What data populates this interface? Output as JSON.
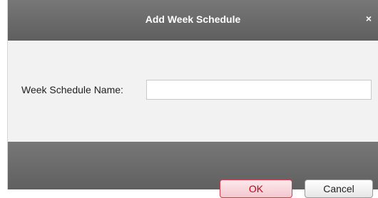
{
  "dialog": {
    "title": "Add Week Schedule",
    "close_icon": "close-icon",
    "close_glyph": "×"
  },
  "form": {
    "name_label": "Week Schedule Name:",
    "name_value": "",
    "name_placeholder": ""
  },
  "buttons": {
    "ok_label": "OK",
    "cancel_label": "Cancel"
  },
  "colors": {
    "titlebar": "#6b6b6b",
    "body": "#f2f2f2",
    "ok_border": "#d23a4d",
    "ok_text": "#c6001a"
  }
}
